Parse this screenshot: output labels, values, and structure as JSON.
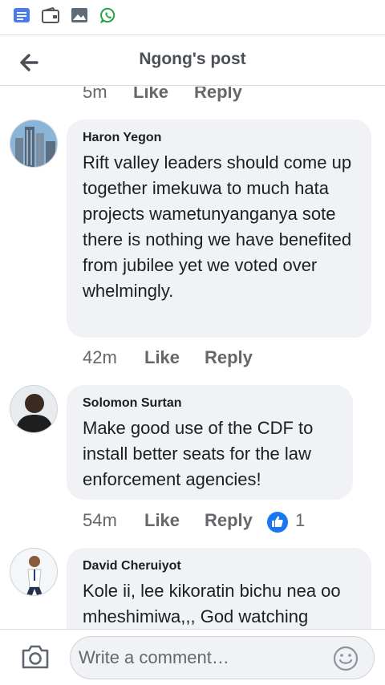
{
  "status_bar": {
    "icons": [
      "notes-icon",
      "wallet-icon",
      "image-icon",
      "whatsapp-icon"
    ]
  },
  "header": {
    "title": "Ngong's post"
  },
  "previous_comment": {
    "time": "5m",
    "like_label": "Like",
    "reply_label": "Reply"
  },
  "comments": [
    {
      "author": "Haron Yegon",
      "text": "Rift valley leaders should come up together imekuwa to much hata projects wametunyanganya sote there is nothing we have benefited from jubilee yet we voted over whelmingly.",
      "time": "42m",
      "like_label": "Like",
      "reply_label": "Reply"
    },
    {
      "author": "Solomon Surtan",
      "text": "Make good use of the CDF to install better seats for the law enforcement agencies!",
      "time": "54m",
      "like_label": "Like",
      "reply_label": "Reply",
      "reaction_count": "1"
    },
    {
      "author": "David Cheruiyot",
      "text": "Kole ii, lee kikoratin bichu nea oo mheshimiwa,,, God watching"
    }
  ],
  "composer": {
    "placeholder": "Write a comment…"
  },
  "colors": {
    "accent": "#1877f2",
    "bubble": "#f0f2f5",
    "meta_text": "#65676b",
    "whatsapp": "#25a244",
    "notes": "#4a7cf0"
  }
}
